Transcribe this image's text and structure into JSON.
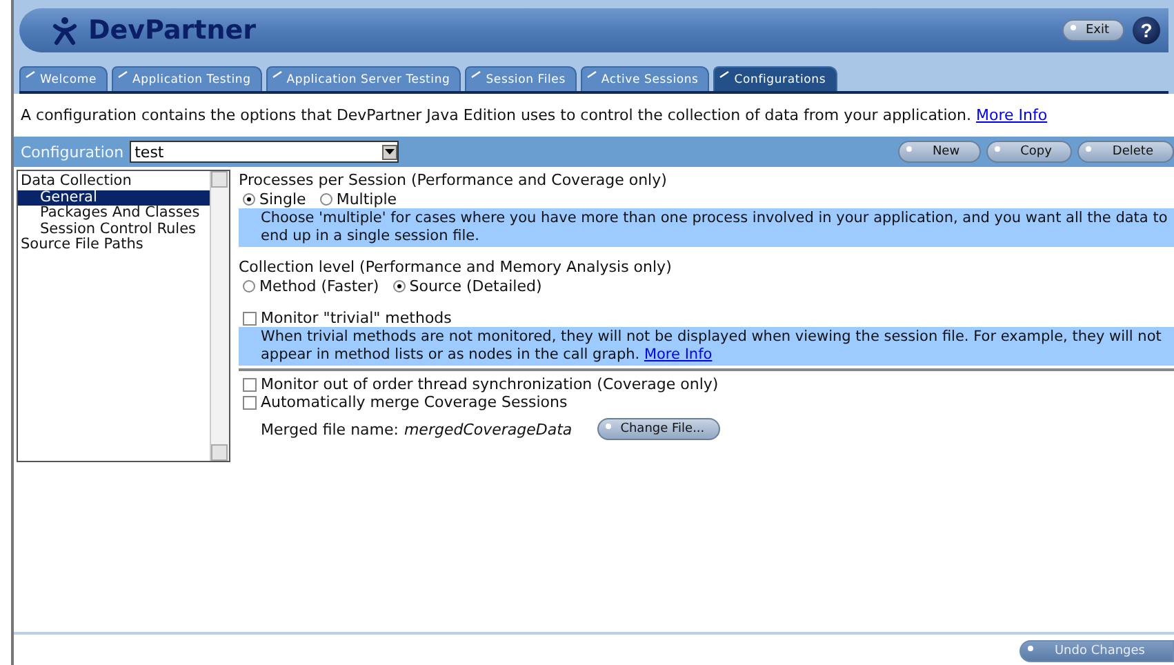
{
  "header": {
    "title": "DevPartner",
    "exit": "Exit",
    "help": "?"
  },
  "tabs": [
    {
      "label": "Welcome",
      "selected": false
    },
    {
      "label": "Application Testing",
      "selected": false
    },
    {
      "label": "Application Server Testing",
      "selected": false
    },
    {
      "label": "Session Files",
      "selected": false
    },
    {
      "label": "Active Sessions",
      "selected": false
    },
    {
      "label": "Configurations",
      "selected": true
    }
  ],
  "description": {
    "text": "A configuration contains the options that DevPartner Java Edition uses to control the collection of data from your application.",
    "link": "More Info"
  },
  "config_bar": {
    "label": "Configuration",
    "value": "test",
    "buttons": [
      "New",
      "Copy",
      "Delete"
    ]
  },
  "tree": [
    {
      "label": "Data Collection",
      "selected": false,
      "children": [
        {
          "label": "General",
          "selected": true
        },
        {
          "label": "Packages And Classes",
          "selected": false
        },
        {
          "label": "Session Control Rules",
          "selected": false
        }
      ]
    },
    {
      "label": "Source File Paths",
      "selected": false
    }
  ],
  "processes": {
    "title": "Processes per Session (Performance and Coverage only)",
    "options": [
      {
        "label": "Single",
        "selected": true
      },
      {
        "label": "Multiple",
        "selected": false
      }
    ],
    "help": "Choose 'multiple' for cases where you have more than one process involved in your application, and you want all the data to end up in a single session file."
  },
  "collection_level": {
    "title": "Collection level (Performance and Memory Analysis only)",
    "options": [
      {
        "label": "Method (Faster)",
        "selected": false
      },
      {
        "label": "Source (Detailed)",
        "selected": true
      }
    ]
  },
  "trivial": {
    "label": "Monitor \"trivial\" methods",
    "checked": false,
    "help": "When trivial methods are not monitored, they will not be displayed when viewing the session file. For example, they will not appear in method lists or as nodes in the call graph.",
    "link": "More Info"
  },
  "thread_sync": {
    "label": "Monitor out of order thread synchronization (Coverage only)",
    "checked": false
  },
  "auto_merge": {
    "label": "Automatically merge Coverage Sessions",
    "checked": false,
    "file_label": "Merged file name:",
    "file_value": "mergedCoverageData",
    "button": "Change File..."
  },
  "footer": {
    "button": {
      "label": "Undo Changes",
      "disabled": true
    }
  }
}
